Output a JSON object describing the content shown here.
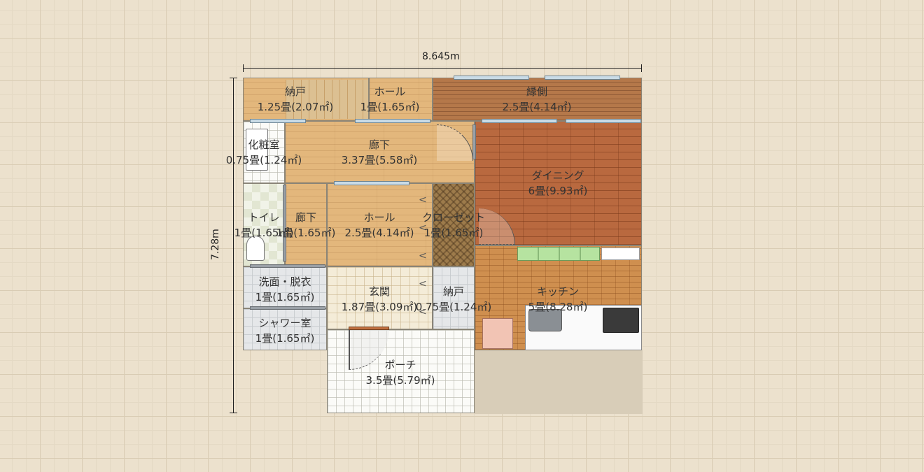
{
  "dimensions": {
    "width": "8.645m",
    "height": "7.28m"
  },
  "rooms": {
    "storage_top": {
      "name": "納戸",
      "area": "1.25畳(2.07㎡)"
    },
    "hall_top": {
      "name": "ホール",
      "area": "1畳(1.65㎡)"
    },
    "engawa": {
      "name": "縁側",
      "area": "2.5畳(4.14㎡)"
    },
    "powder": {
      "name": "化粧室",
      "area": "0.75畳(1.24㎡)"
    },
    "corridor_main": {
      "name": "廊下",
      "area": "3.37畳(5.58㎡)"
    },
    "dining": {
      "name": "ダイニング",
      "area": "6畳(9.93㎡)"
    },
    "toilet": {
      "name": "トイレ",
      "area": "1畳(1.65㎡)"
    },
    "corridor_small": {
      "name": "廊下",
      "area": "1畳(1.65㎡)"
    },
    "hall_mid": {
      "name": "ホール",
      "area": "2.5畳(4.14㎡)"
    },
    "closet": {
      "name": "クローゼット",
      "area": "1畳(1.65㎡)"
    },
    "washroom": {
      "name": "洗面・脱衣",
      "area": "1畳(1.65㎡)"
    },
    "entrance": {
      "name": "玄関",
      "area": "1.87畳(3.09㎡)"
    },
    "storage_mid": {
      "name": "納戸",
      "area": "0.75畳(1.24㎡)"
    },
    "kitchen": {
      "name": "キッチン",
      "area": "5畳(8.28㎡)"
    },
    "shower": {
      "name": "シャワー室",
      "area": "1畳(1.65㎡)"
    },
    "porch": {
      "name": "ポーチ",
      "area": "3.5畳(5.79㎡)"
    }
  }
}
